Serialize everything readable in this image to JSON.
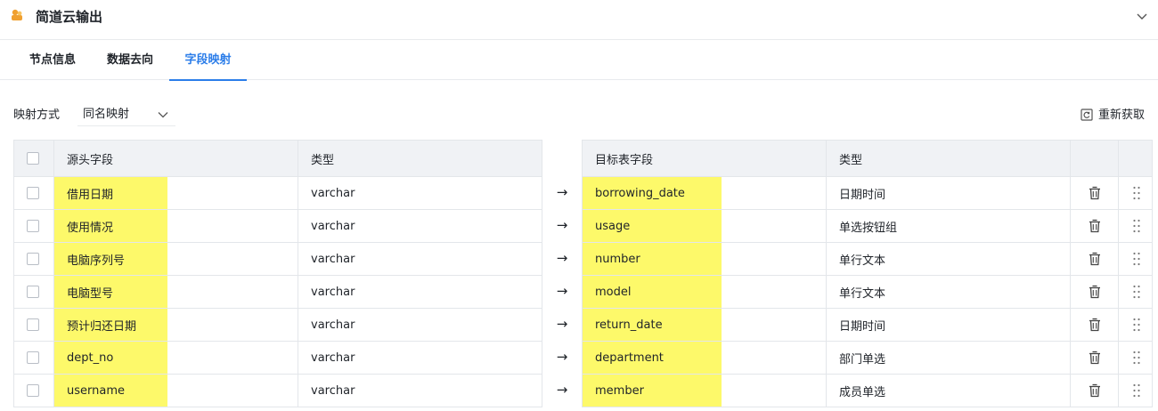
{
  "header": {
    "title": "简道云输出",
    "logo_icon": "cloud-output-icon",
    "collapse_icon": "chevron-down-icon"
  },
  "tabs": [
    {
      "label": "节点信息",
      "active": false
    },
    {
      "label": "数据去向",
      "active": false
    },
    {
      "label": "字段映射",
      "active": true
    }
  ],
  "mapping": {
    "label": "映射方式",
    "value": "同名映射"
  },
  "refresh": {
    "label": "重新获取",
    "icon": "refresh-icon"
  },
  "source_table": {
    "columns": [
      "源头字段",
      "类型"
    ],
    "rows": [
      {
        "field": "借用日期",
        "type": "varchar"
      },
      {
        "field": "使用情况",
        "type": "varchar"
      },
      {
        "field": "电脑序列号",
        "type": "varchar"
      },
      {
        "field": "电脑型号",
        "type": "varchar"
      },
      {
        "field": "预计归还日期",
        "type": "varchar"
      },
      {
        "field": "dept_no",
        "type": "varchar"
      },
      {
        "field": "username",
        "type": "varchar"
      }
    ]
  },
  "arrow": "→",
  "target_table": {
    "columns": [
      "目标表字段",
      "类型"
    ],
    "rows": [
      {
        "field": "borrowing_date",
        "type": "日期时间"
      },
      {
        "field": "usage",
        "type": "单选按钮组"
      },
      {
        "field": "number",
        "type": "单行文本"
      },
      {
        "field": "model",
        "type": "单行文本"
      },
      {
        "field": "return_date",
        "type": "日期时间"
      },
      {
        "field": "department",
        "type": "部门单选"
      },
      {
        "field": "member",
        "type": "成员单选"
      }
    ]
  },
  "highlight_color": "#fdf96a",
  "accent_color": "#2b7de9"
}
